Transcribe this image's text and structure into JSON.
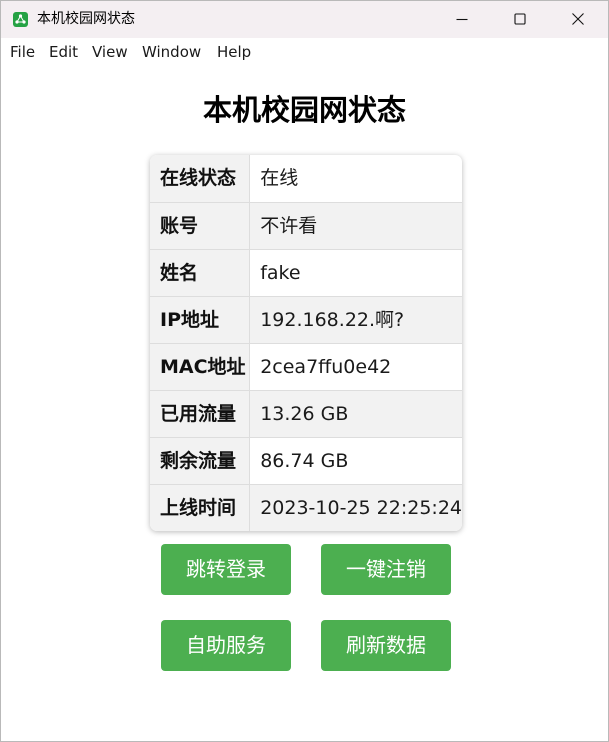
{
  "window": {
    "title": "本机校园网状态",
    "icon": "app-icon",
    "controls": [
      "minimize-icon",
      "maximize-icon",
      "close-icon"
    ]
  },
  "menu": {
    "items": [
      "File",
      "Edit",
      "View",
      "Window",
      "Help"
    ]
  },
  "page": {
    "title": "本机校园网状态"
  },
  "info_table": {
    "rows": [
      {
        "label": "在线状态",
        "value": "在线"
      },
      {
        "label": "账号",
        "value": "不许看"
      },
      {
        "label": "姓名",
        "value": "fake"
      },
      {
        "label": "IP地址",
        "value": "192.168.22.啊?"
      },
      {
        "label": "MAC地址",
        "value": "2cea7ffu0e42"
      },
      {
        "label": "已用流量",
        "value": "13.26 GB"
      },
      {
        "label": "剩余流量",
        "value": "86.74 GB"
      },
      {
        "label": "上线时间",
        "value": "2023-10-25 22:25:24"
      }
    ]
  },
  "actions": {
    "login": "跳转登录",
    "logout": "一键注销",
    "self_service": "自助服务",
    "refresh": "刷新数据"
  },
  "colors": {
    "button": "#4caf50",
    "app_icon": "#25a244",
    "titlebar": "#f4eff2"
  }
}
